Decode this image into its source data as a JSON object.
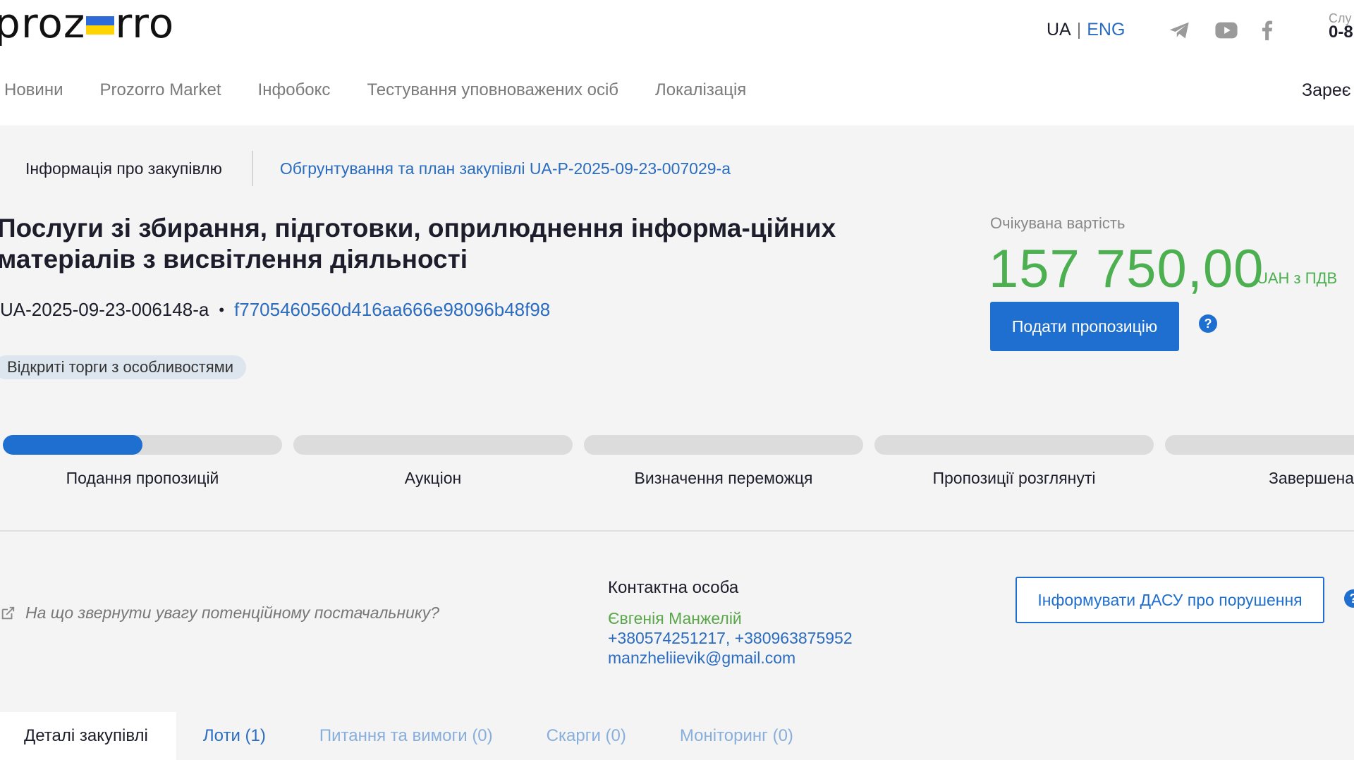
{
  "header": {
    "logo_left": "proz",
    "logo_right": "rro",
    "lang_ua": "UA",
    "lang_separator": "|",
    "lang_eng": "ENG",
    "hotline_label": "Слу",
    "hotline_number": "0-8",
    "register_label": "Зареє",
    "nav": [
      "Новини",
      "Prozorro Market",
      "Інфобокс",
      "Тестування уповноважених осіб",
      "Локалізація"
    ],
    "icons": [
      "telegram-icon",
      "youtube-icon",
      "facebook-icon"
    ]
  },
  "subtabs": {
    "info": "Інформація про закупівлю",
    "plan": "Обгрунтування та план закупівлі UA-P-2025-09-23-007029-a"
  },
  "tender": {
    "title": "Послуги зі збирання, підготовки, оприлюднення інформа-ційних матеріалів з висвітлення діяльності",
    "id": "UA-2025-09-23-006148-a",
    "separator": "•",
    "hash": "f7705460560d416aa666e98096b48f98",
    "procedure": "Відкриті торги з особливостями"
  },
  "price": {
    "label": "Очікувана вартість",
    "value": "157 750,00",
    "unit": "UAH з ПДВ",
    "submit_label": "Подати пропозицію",
    "help_glyph": "?"
  },
  "stages": [
    {
      "label": "Подання пропозицій",
      "progress": 0.5
    },
    {
      "label": "Аукціон",
      "progress": 0
    },
    {
      "label": "Визначення переможця",
      "progress": 0
    },
    {
      "label": "Пропозиції розглянуті",
      "progress": 0
    },
    {
      "label": "Завершена",
      "progress": 0
    }
  ],
  "hint": "На що звернути увагу потенційному постачальнику?",
  "contact": {
    "title": "Контактна особа",
    "name": "Євгенія Манжелій",
    "phones": "+380574251217, +380963875952",
    "email": "manzheliievik@gmail.com"
  },
  "dasu_label": "Інформувати ДАСУ про порушення",
  "tabs": [
    "Деталі закупівлі",
    "Лоти (1)",
    "Питання та вимоги (0)",
    "Скарги (0)",
    "Моніторинг (0)"
  ],
  "colors": {
    "accent": "#1f6fd0",
    "link": "#2a6cc0",
    "price": "#4caf50",
    "background": "#f4f4f4"
  }
}
